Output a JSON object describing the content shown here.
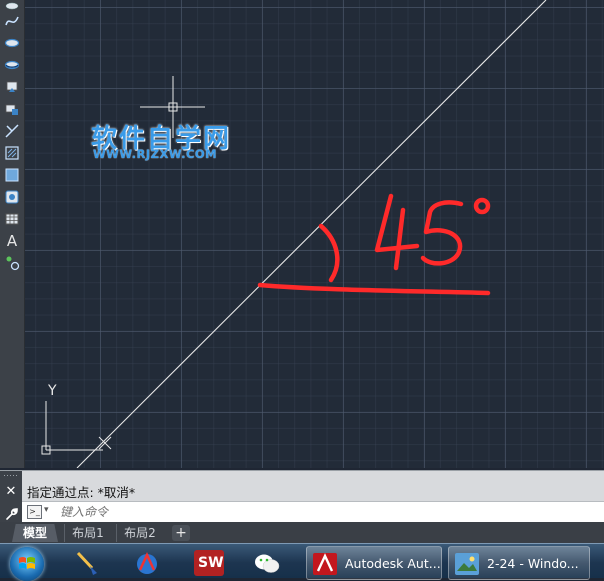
{
  "toolbar": {
    "tools": [
      {
        "icon": "line-icon"
      },
      {
        "icon": "spline-icon"
      },
      {
        "icon": "ellipse-icon"
      },
      {
        "icon": "ellipse-arc-icon"
      },
      {
        "icon": "insert-block-icon"
      },
      {
        "icon": "make-block-icon"
      },
      {
        "icon": "point-icon"
      },
      {
        "icon": "hatch-icon"
      },
      {
        "icon": "gradient-icon"
      },
      {
        "icon": "region-icon"
      },
      {
        "icon": "table-icon"
      },
      {
        "icon": "multiline-text-icon",
        "text": "A"
      },
      {
        "icon": "add-selected-icon"
      }
    ]
  },
  "drawing": {
    "watermark_title": "软件自学网",
    "watermark_url": "WWW.RJZXW.COM",
    "annotation_text": "45°",
    "ucs_y_label": "Y",
    "accent_color": "#ff2a2a",
    "line_color": "#e8e8e8"
  },
  "command": {
    "history": "指定通过点: *取消*",
    "input_placeholder": "键入命令",
    "prompt_icon": ">_"
  },
  "layout_tabs": {
    "model": "模型",
    "layout1": "布局1",
    "layout2": "布局2",
    "add": "+"
  },
  "taskbar": {
    "buttons": [
      {
        "label": "Autodesk Aut...",
        "icon": "autocad-icon"
      },
      {
        "label": "2-24 - Windo...",
        "icon": "photo-viewer-icon"
      }
    ],
    "pinned": [
      "paint-brush-icon",
      "compass-app-icon",
      "solidworks-icon",
      "wechat-icon"
    ],
    "solidworks_label": "SW"
  }
}
